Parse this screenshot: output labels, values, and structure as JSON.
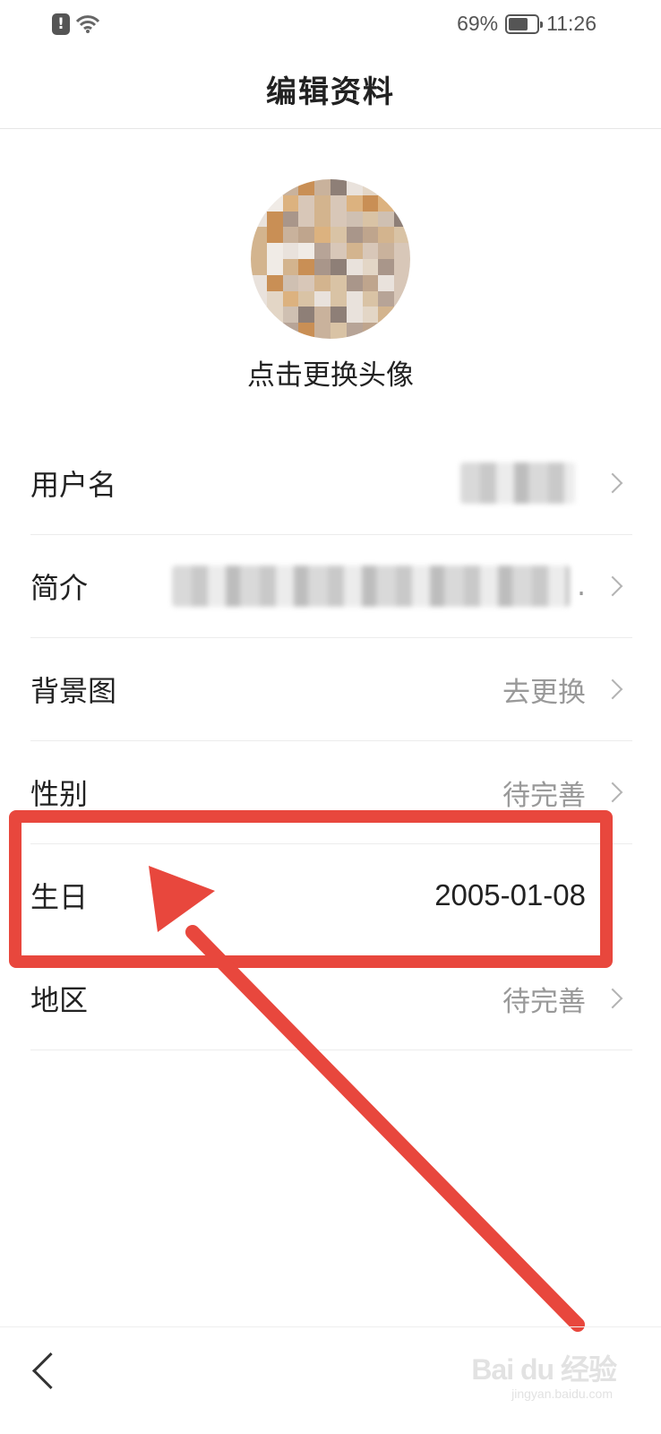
{
  "status_bar": {
    "battery_percent": "69%",
    "time": "11:26",
    "battery_level": 0.69,
    "icons": [
      "alert-icon",
      "wifi-icon",
      "battery-icon"
    ]
  },
  "header": {
    "title": "编辑资料"
  },
  "avatar": {
    "caption": "点击更换头像",
    "state": "pixelated"
  },
  "rows": [
    {
      "label": "用户名",
      "value": "",
      "blurred": true
    },
    {
      "label": "简介",
      "value": ".",
      "blurred": true
    },
    {
      "label": "背景图",
      "value": "去更换"
    },
    {
      "label": "性别",
      "value": "待完善"
    },
    {
      "label": "生日",
      "value": "2005-01-08"
    },
    {
      "label": "地区",
      "value": "待完善"
    }
  ],
  "annotation": {
    "highlight_color": "#e8473d",
    "highlighted_row": "生日"
  },
  "watermark": {
    "brand": "Bai du 经验",
    "url": "jingyan.baidu.com"
  },
  "colors": {
    "accent": "#e8473d",
    "muted_text": "#999999",
    "text": "#222222"
  }
}
